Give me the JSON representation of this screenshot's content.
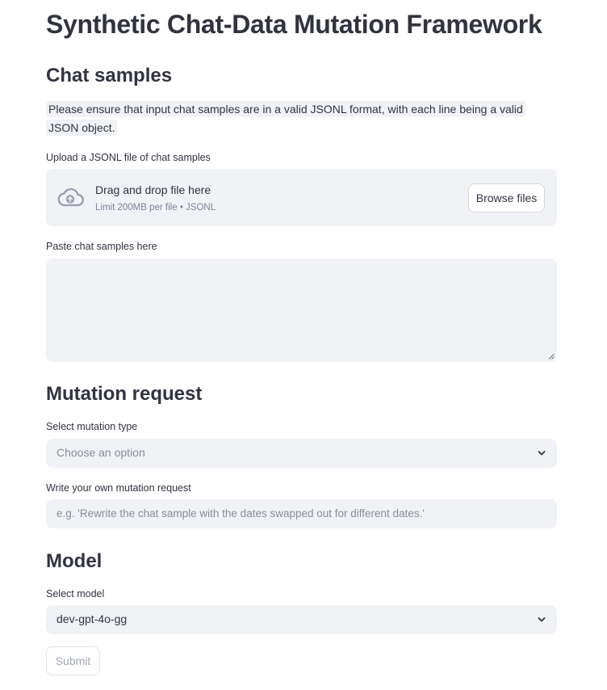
{
  "page": {
    "title": "Synthetic Chat-Data Mutation Framework"
  },
  "chat_samples": {
    "heading": "Chat samples",
    "note": "Please ensure that input chat samples are in a valid JSONL format, with each line being a valid JSON object.",
    "upload": {
      "label": "Upload a JSONL file of chat samples",
      "drag_text": "Drag and drop file here",
      "limit_text": "Limit 200MB per file • JSONL",
      "browse_label": "Browse files",
      "icon": "cloud-upload-icon"
    },
    "paste": {
      "label": "Paste chat samples here",
      "value": ""
    }
  },
  "mutation": {
    "heading": "Mutation request",
    "type_label": "Select mutation type",
    "type_placeholder": "Choose an option",
    "custom_label": "Write your own mutation request",
    "custom_placeholder": "e.g. 'Rewrite the chat sample with the dates swapped out for different dates.'"
  },
  "model": {
    "heading": "Model",
    "select_label": "Select model",
    "selected": "dev-gpt-4o-gg"
  },
  "actions": {
    "submit_label": "Submit"
  },
  "colors": {
    "text": "#31333f",
    "input_bg": "#f0f2f6",
    "muted": "#808495",
    "disabled": "#a3a8b4"
  }
}
